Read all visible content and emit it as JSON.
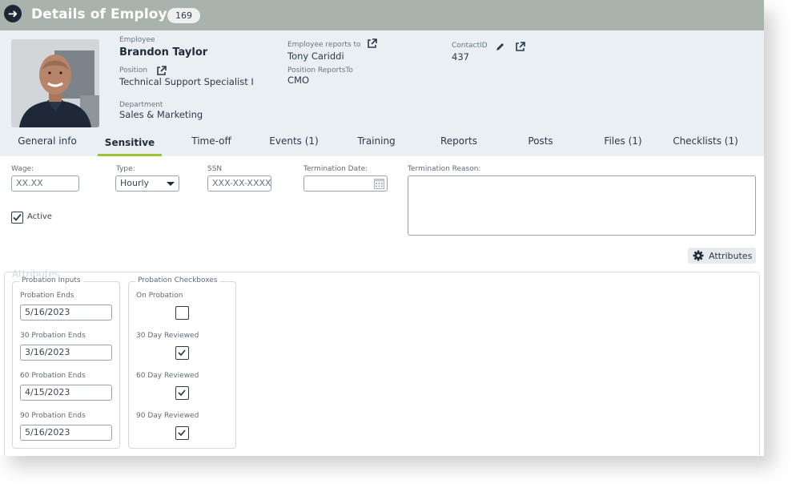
{
  "window": {
    "title": "Details of Employee",
    "count": "169"
  },
  "header": {
    "employee_label": "Employee",
    "employee_name": "Brandon Taylor",
    "position_label": "Position",
    "position_value": "Technical Support Specialist I",
    "department_label": "Department",
    "department_value": "Sales & Marketing",
    "reports_to_label": "Employee reports to",
    "reports_to_value": "Tony Cariddi",
    "position_reports_label": "Position ReportsTo",
    "position_reports_value": "CMO",
    "contact_label": "ContactID",
    "contact_value": "437"
  },
  "tabs": [
    {
      "label": "General info"
    },
    {
      "label": "Sensitive",
      "active": true
    },
    {
      "label": "Time-off"
    },
    {
      "label": "Events (1)"
    },
    {
      "label": "Training"
    },
    {
      "label": "Reports"
    },
    {
      "label": "Posts"
    },
    {
      "label": "Files (1)"
    },
    {
      "label": "Checklists (1)"
    }
  ],
  "form": {
    "wage_label": "Wage:",
    "wage_placeholder": "XX.XX",
    "type_label": "Type:",
    "type_value": "Hourly",
    "ssn_label": "SSN",
    "ssn_placeholder": "XXX-XX-XXXX",
    "termination_date_label": "Termination Date:",
    "termination_reason_label": "Termination Reason:",
    "active_label": "Active",
    "active_checked": true
  },
  "attributes_button": "Attributes",
  "attributes_section": {
    "legend": "Attributes",
    "probation_inputs": {
      "title": "Probation Inputs",
      "fields": [
        {
          "label": "Probation Ends",
          "value": "5/16/2023"
        },
        {
          "label": "30 Probation Ends",
          "value": "3/16/2023"
        },
        {
          "label": "60 Probation Ends",
          "value": "4/15/2023"
        },
        {
          "label": "90 Probation Ends",
          "value": "5/16/2023"
        }
      ]
    },
    "probation_checkboxes": {
      "title": "Probation Checkboxes",
      "items": [
        {
          "label": "On Probation",
          "checked": false
        },
        {
          "label": "30 Day Reviewed",
          "checked": true
        },
        {
          "label": "60 Day Reviewed",
          "checked": true
        },
        {
          "label": "90 Day Reviewed",
          "checked": true
        }
      ]
    }
  },
  "colors": {
    "title_bar": "#a9b3ad",
    "header_bg": "#e9eff3",
    "active_tab_underline": "#9ac53a"
  }
}
